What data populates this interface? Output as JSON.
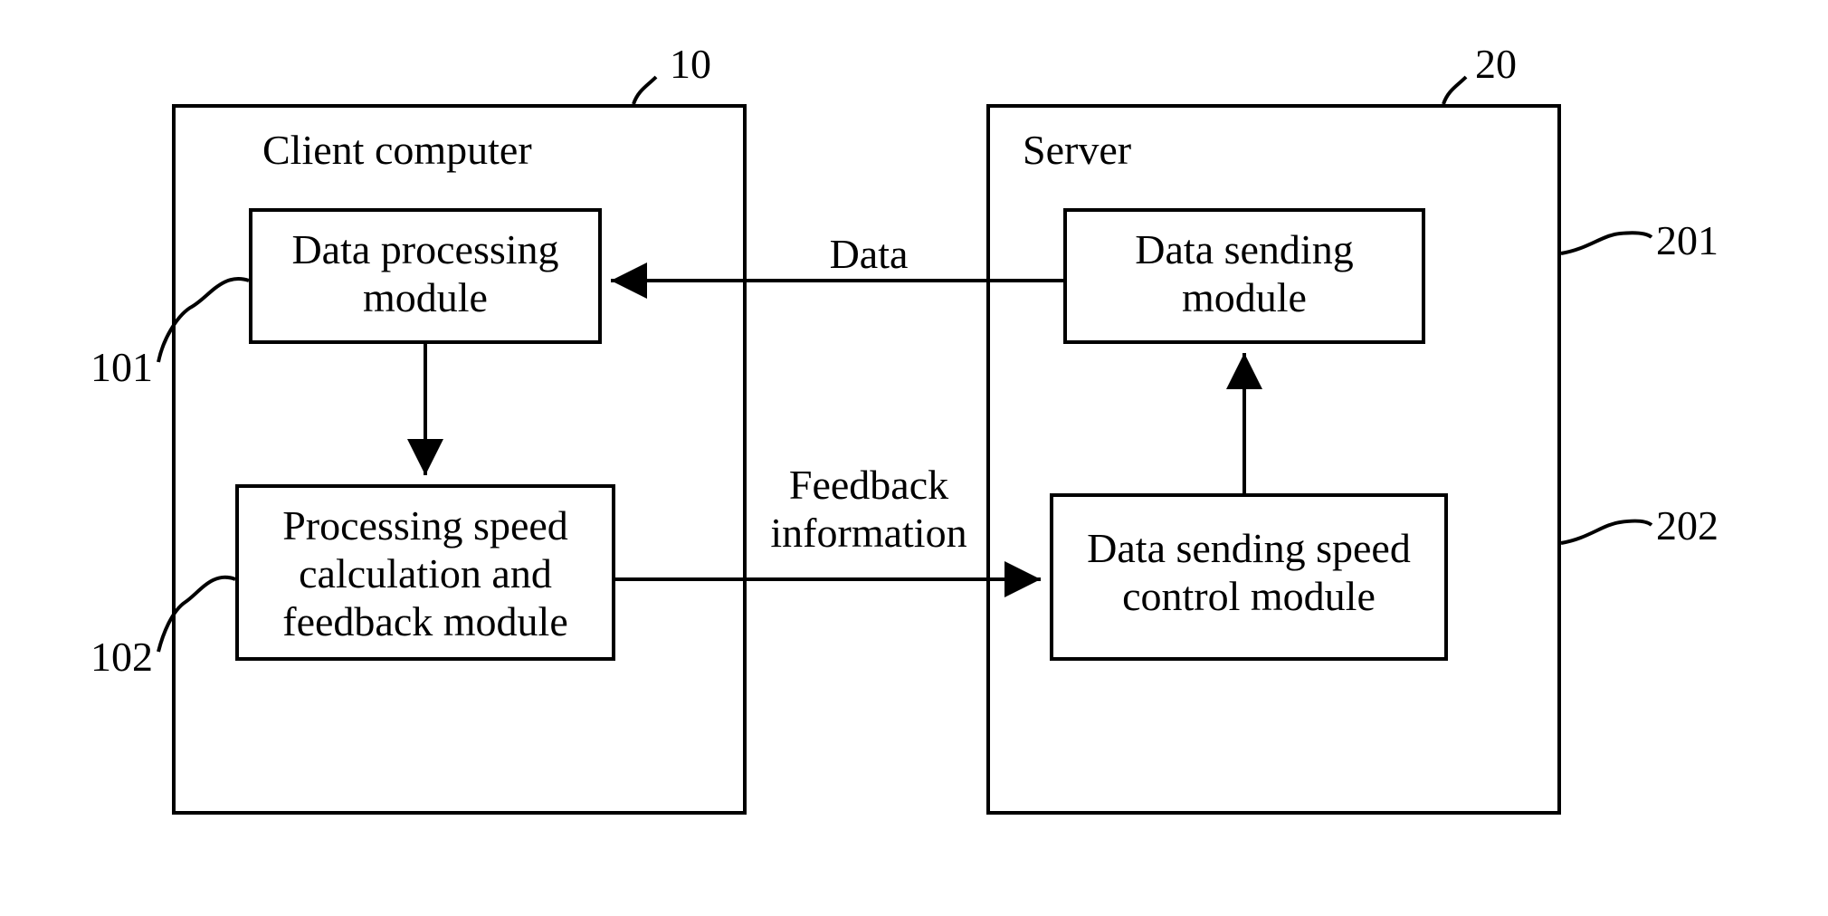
{
  "client": {
    "title": "Client computer",
    "ref": "10",
    "module1": {
      "text": "Data processing\nmodule",
      "ref": "101"
    },
    "module2": {
      "text": "Processing speed\ncalculation and\nfeedback module",
      "ref": "102"
    }
  },
  "server": {
    "title": "Server",
    "ref": "20",
    "module1": {
      "text": "Data sending\nmodule",
      "ref": "201"
    },
    "module2": {
      "text": "Data sending speed\ncontrol module",
      "ref": "202"
    }
  },
  "arrows": {
    "data": "Data",
    "feedback": "Feedback\ninformation"
  }
}
